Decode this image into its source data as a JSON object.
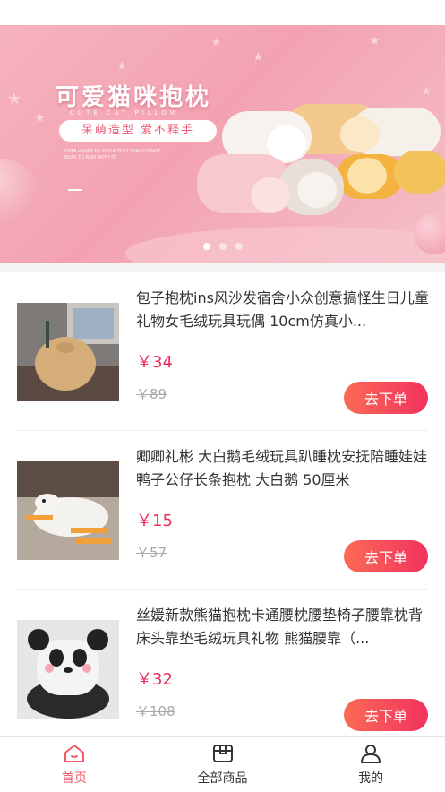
{
  "banner": {
    "title": "可爱猫咪抱枕",
    "subtitle": "CUTE CAT PILLOW",
    "slogan": "呆萌造型  爱不释手",
    "description": "CUTE LOOKS SO MUCH THAT ONE CANNOT BEAR TO PART WITH IT",
    "dots": 3,
    "active_dot": 0
  },
  "products": [
    {
      "name": "包子抱枕ins风沙发宿舍小众创意搞怪生日儿童礼物女毛绒玩具玩偶 10cm仿真小...",
      "price": "￥34",
      "original_price": "￥89",
      "button": "去下单"
    },
    {
      "name": "卿卿礼彬 大白鹅毛绒玩具趴睡枕安抚陪睡娃娃鸭子公仔长条抱枕 大白鹅 50厘米",
      "price": "￥15",
      "original_price": "￥57",
      "button": "去下单"
    },
    {
      "name": "丝媛新款熊猫抱枕卡通腰枕腰垫椅子腰靠枕背床头靠垫毛绒玩具礼物 熊猫腰靠（...",
      "price": "￥32",
      "original_price": "￥108",
      "button": "去下单"
    }
  ],
  "tabbar": {
    "items": [
      {
        "label": "首页",
        "icon": "home-icon",
        "active": true
      },
      {
        "label": "全部商品",
        "icon": "box-icon",
        "active": false
      },
      {
        "label": "我的",
        "icon": "user-icon",
        "active": false
      }
    ]
  },
  "colors": {
    "accent": "#f05a6b",
    "price": "#e8315a",
    "banner": "#f3a2b1"
  }
}
